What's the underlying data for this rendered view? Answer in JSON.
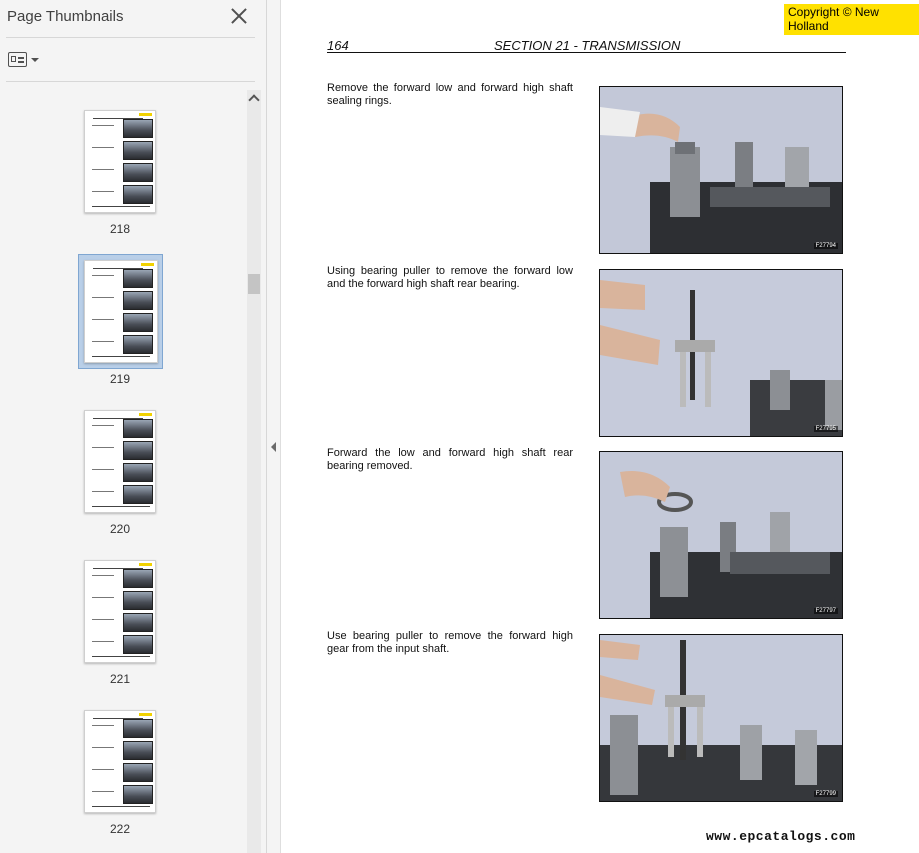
{
  "sidebar": {
    "title": "Page Thumbnails",
    "close_icon": "close-icon",
    "options_icon": "thumbnail-options-icon",
    "thumbnails": [
      {
        "label": "218",
        "selected": false
      },
      {
        "label": "219",
        "selected": true
      },
      {
        "label": "220",
        "selected": false
      },
      {
        "label": "221",
        "selected": false
      },
      {
        "label": "222",
        "selected": false
      }
    ]
  },
  "document": {
    "copyright": "Copyright © New Holland",
    "page_number": "164",
    "section_title": "SECTION 21 - TRANSMISSION",
    "steps": [
      {
        "text": "Remove the forward low and forward high shaft sealing rings.",
        "photo_code": "F27794"
      },
      {
        "text": "Using bearing puller to remove the forward low and the forward high shaft rear bearing.",
        "photo_code": "F27795"
      },
      {
        "text": "Forward the low and forward high shaft rear bearing removed.",
        "photo_code": "F27797"
      },
      {
        "text": "Use bearing puller to remove the forward high gear from the input shaft.",
        "photo_code": "F27799"
      }
    ],
    "watermark": "www.epcatalogs.com"
  },
  "colors": {
    "pane_bg": "#f4f4f4",
    "selected_thumb": "#b9cfe8",
    "copyright_bg": "#ffe100"
  }
}
